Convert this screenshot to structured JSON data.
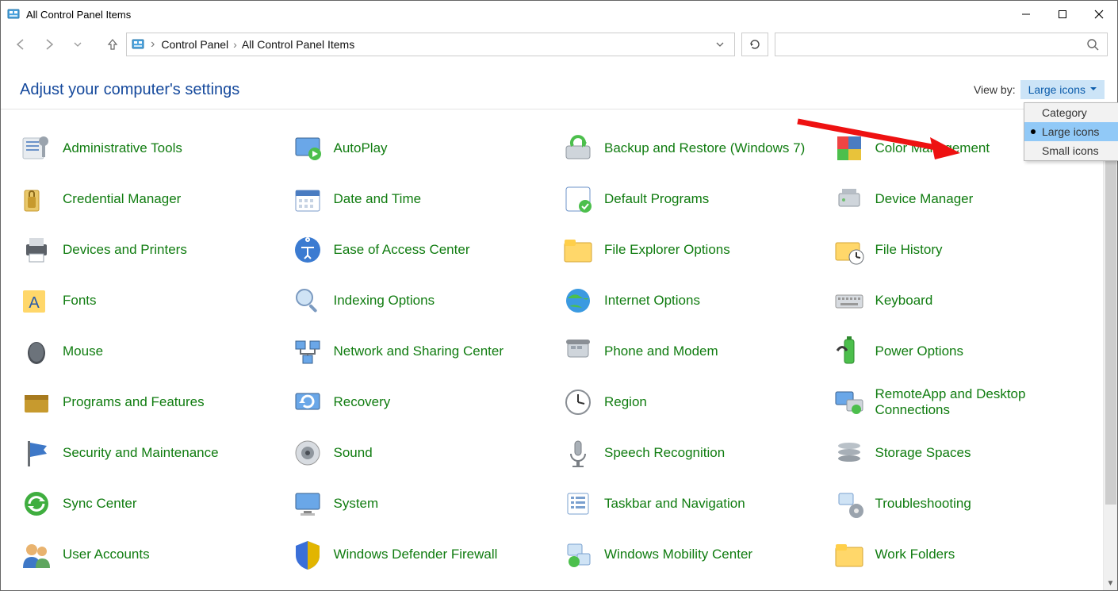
{
  "window": {
    "title": "All Control Panel Items"
  },
  "breadcrumbs": [
    "Control Panel",
    "All Control Panel Items"
  ],
  "header": {
    "title": "Adjust your computer's settings"
  },
  "viewby": {
    "label": "View by:",
    "value": "Large icons",
    "options": [
      "Category",
      "Large icons",
      "Small icons"
    ],
    "selected": "Large icons"
  },
  "items": [
    {
      "label": "Administrative Tools"
    },
    {
      "label": "AutoPlay"
    },
    {
      "label": "Backup and Restore (Windows 7)"
    },
    {
      "label": "Color Management"
    },
    {
      "label": "Credential Manager"
    },
    {
      "label": "Date and Time"
    },
    {
      "label": "Default Programs"
    },
    {
      "label": "Device Manager"
    },
    {
      "label": "Devices and Printers"
    },
    {
      "label": "Ease of Access Center"
    },
    {
      "label": "File Explorer Options"
    },
    {
      "label": "File History"
    },
    {
      "label": "Fonts"
    },
    {
      "label": "Indexing Options"
    },
    {
      "label": "Internet Options"
    },
    {
      "label": "Keyboard"
    },
    {
      "label": "Mouse"
    },
    {
      "label": "Network and Sharing Center"
    },
    {
      "label": "Phone and Modem"
    },
    {
      "label": "Power Options"
    },
    {
      "label": "Programs and Features"
    },
    {
      "label": "Recovery"
    },
    {
      "label": "Region"
    },
    {
      "label": "RemoteApp and Desktop Connections"
    },
    {
      "label": "Security and Maintenance"
    },
    {
      "label": "Sound"
    },
    {
      "label": "Speech Recognition"
    },
    {
      "label": "Storage Spaces"
    },
    {
      "label": "Sync Center"
    },
    {
      "label": "System"
    },
    {
      "label": "Taskbar and Navigation"
    },
    {
      "label": "Troubleshooting"
    },
    {
      "label": "User Accounts"
    },
    {
      "label": "Windows Defender Firewall"
    },
    {
      "label": "Windows Mobility Center"
    },
    {
      "label": "Work Folders"
    }
  ]
}
